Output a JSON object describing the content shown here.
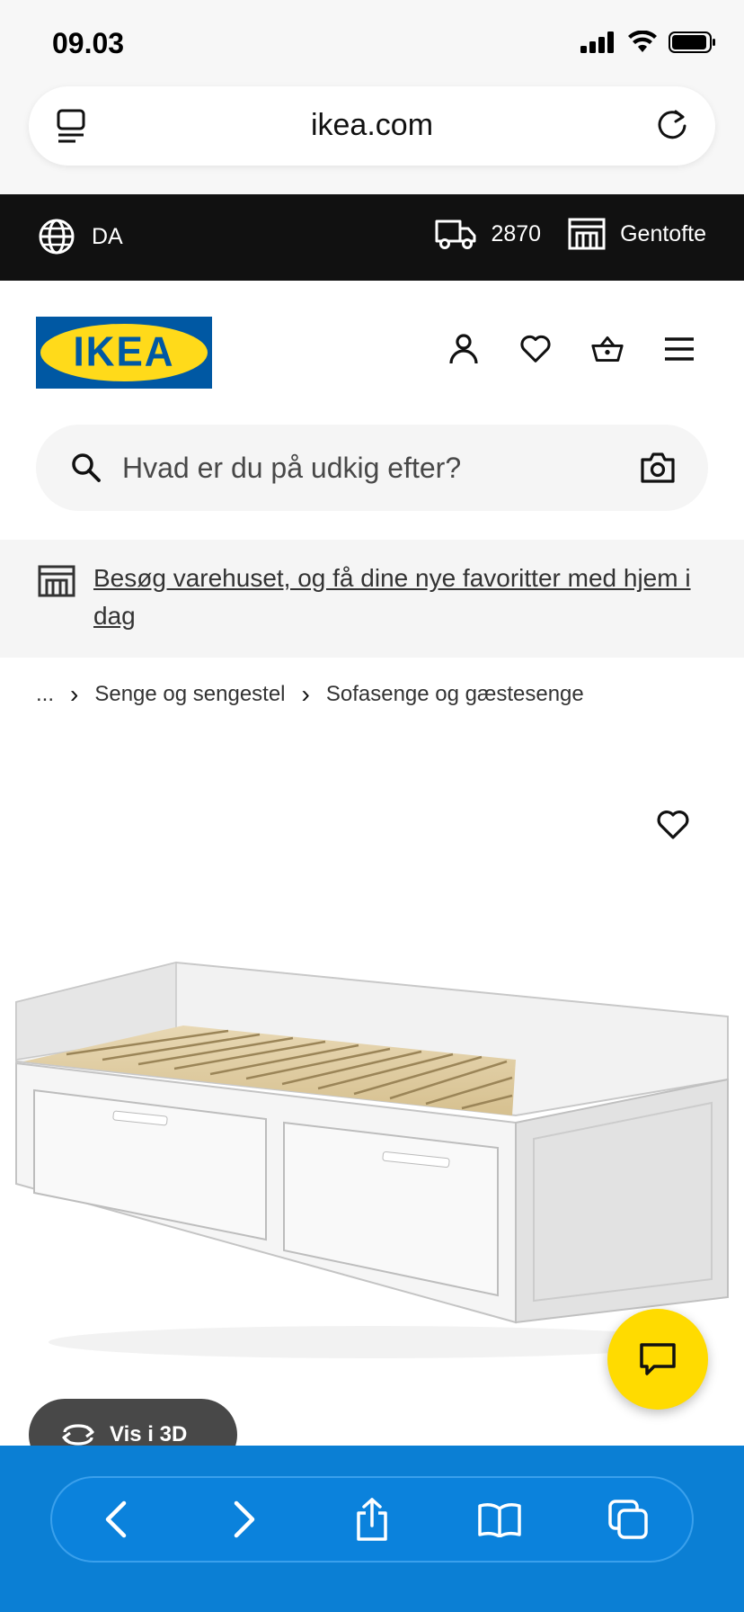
{
  "status_bar": {
    "time": "09.03"
  },
  "browser": {
    "url": "ikea.com"
  },
  "topbar": {
    "language": "DA",
    "postal_code": "2870",
    "store": "Gentofte"
  },
  "header": {
    "logo_text": "IKEA"
  },
  "search": {
    "placeholder": "Hvad er du på udkig efter?"
  },
  "banner": {
    "text": "Besøg varehuset, og få dine nye favoritter med hjem i dag"
  },
  "breadcrumb": {
    "ellipsis": "...",
    "items": [
      "Senge og sengestel",
      "Sofasenge og gæstesenge"
    ]
  },
  "product": {
    "view_3d_label": "Vis i 3D"
  },
  "colors": {
    "ikea_blue": "#0058a3",
    "ikea_yellow": "#ffda1a",
    "safari_blue": "#0b7fd4"
  }
}
